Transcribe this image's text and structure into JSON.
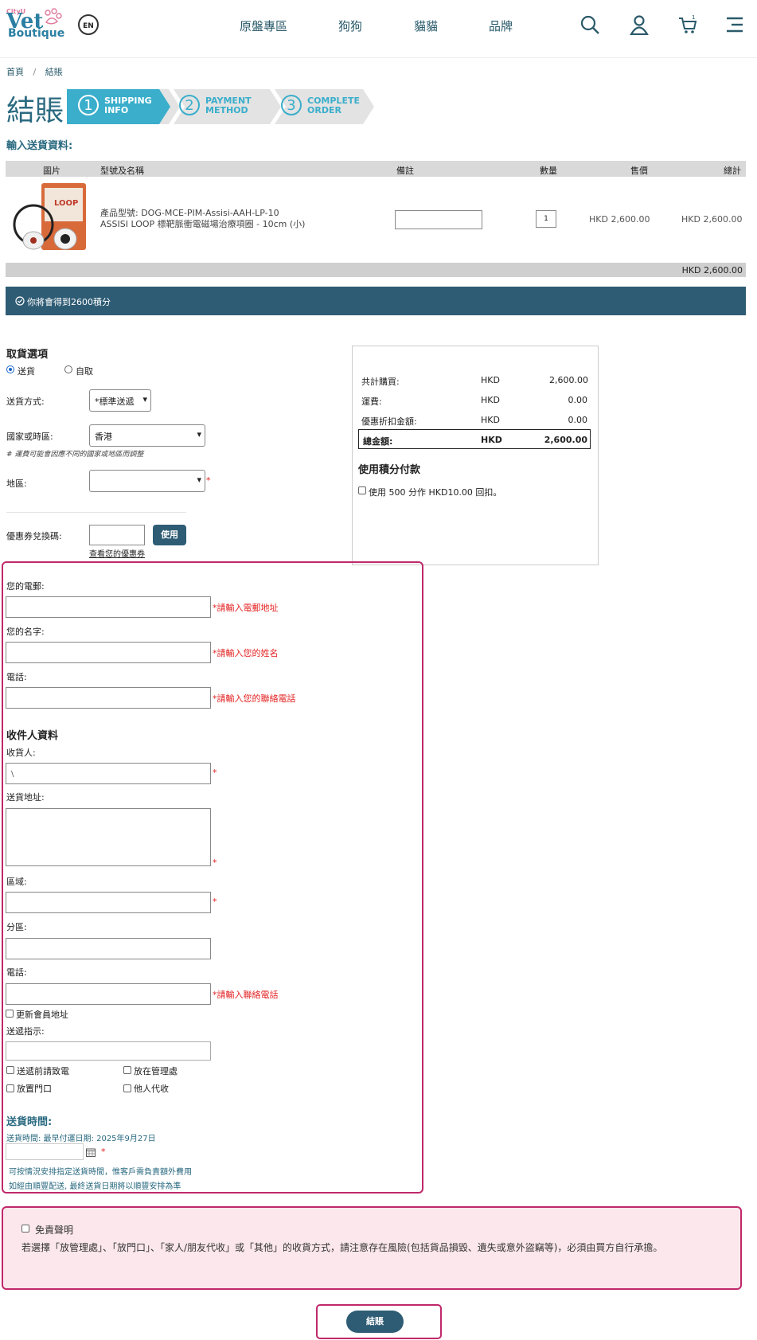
{
  "header": {
    "logo_top": "CityU",
    "logo_main": "Vet",
    "logo_sub": "Boutique",
    "lang_label": "EN",
    "nav": [
      "原盤專區",
      "狗狗",
      "貓貓",
      "品牌"
    ]
  },
  "breadcrumb": {
    "home": "首頁",
    "sep": "/",
    "current": "結賬"
  },
  "page_title": "結賬",
  "steps": [
    {
      "num": "1",
      "label1": "SHIPPING",
      "label2": "INFO"
    },
    {
      "num": "2",
      "label1": "PAYMENT",
      "label2": "METHOD"
    },
    {
      "num": "3",
      "label1": "COMPLETE",
      "label2": "ORDER"
    }
  ],
  "section_shipping_label": "輸入送貨資料:",
  "table": {
    "headers": [
      "圖片",
      "型號及名稱",
      "備註",
      "數量",
      "售價",
      "總計"
    ],
    "item": {
      "model": "產品型號: DOG-MCE-PIM-Assisi-AAH-LP-10",
      "name": "ASSISI LOOP 標靶脈衝電磁場治療項圈 - 10cm (小)",
      "qty": "1",
      "price": "HKD 2,600.00",
      "total": "HKD 2,600.00"
    },
    "grand_total": "HKD 2,600.00"
  },
  "points_banner": "你將會得到2600積分",
  "pickup": {
    "title": "取貨選項",
    "opt_delivery": "送貨",
    "opt_self": "自取"
  },
  "ship_method": {
    "label": "送貨方式:",
    "value": "*標準送遞"
  },
  "country": {
    "label": "國家或時區:",
    "value": "香港",
    "note": "# 運費可能會因應不同的國家或地區而調整"
  },
  "region": {
    "label": "地區:",
    "value": ""
  },
  "coupon": {
    "label": "優惠券兌換碼:",
    "button": "使用",
    "link": "查看您的優惠券"
  },
  "summary": {
    "rows": [
      {
        "label": "共計購買:",
        "cur": "HKD",
        "amt": "2,600.00"
      },
      {
        "label": "運費:",
        "cur": "HKD",
        "amt": "0.00"
      },
      {
        "label": "優惠折扣金額:",
        "cur": "HKD",
        "amt": "0.00"
      }
    ],
    "total": {
      "label": "總金額:",
      "cur": "HKD",
      "amt": "2,600.00"
    },
    "points_title": "使用積分付款",
    "points_option": "使用 500 分作 HKD10.00 回扣。"
  },
  "contact": {
    "email_label": "您的電郵:",
    "email_err": "*請輸入電郵地址",
    "name_label": "您的名字:",
    "name_err": "*請輸入您的姓名",
    "phone_label": "電話:",
    "phone_err": "*請輸入您的聯絡電話"
  },
  "recipient": {
    "title": "收件人資料",
    "name_label": "收貨人:",
    "name_value": "\\",
    "addr_label": "送貨地址:",
    "district_label": "區域:",
    "subdistrict_label": "分區:",
    "phone_label": "電話:",
    "phone_err": "*請輸入聯絡電話",
    "update_label": "更新會員地址",
    "instr_label": "送遞指示:",
    "opts": [
      "送遞前請致電",
      "放在管理處",
      "放置門口",
      "他人代收"
    ]
  },
  "delivery_time": {
    "title": "送貨時間:",
    "earliest": "送貨時間: 最早付運日期: 2025年9月27日",
    "note1": "可按情況安排指定送貨時間，惟客戶需負責額外費用",
    "note2": "如經由順豐配送, 最終送貨日期將以順豐安排為準"
  },
  "disclaimer": {
    "title": "免責聲明",
    "text": "若選擇「放管理處」、「放門口」、「家人/朋友代收」或「其他」的收貨方式，請注意存在風險(包括貨品損毀、遺失或意外盜竊等)，必須由買方自行承擔。"
  },
  "checkout_button": "結賬",
  "colors": {
    "teal": "#2e5c74",
    "step_active": "#3aaecb",
    "pink_border": "#c0286a",
    "error": "#e32222"
  }
}
